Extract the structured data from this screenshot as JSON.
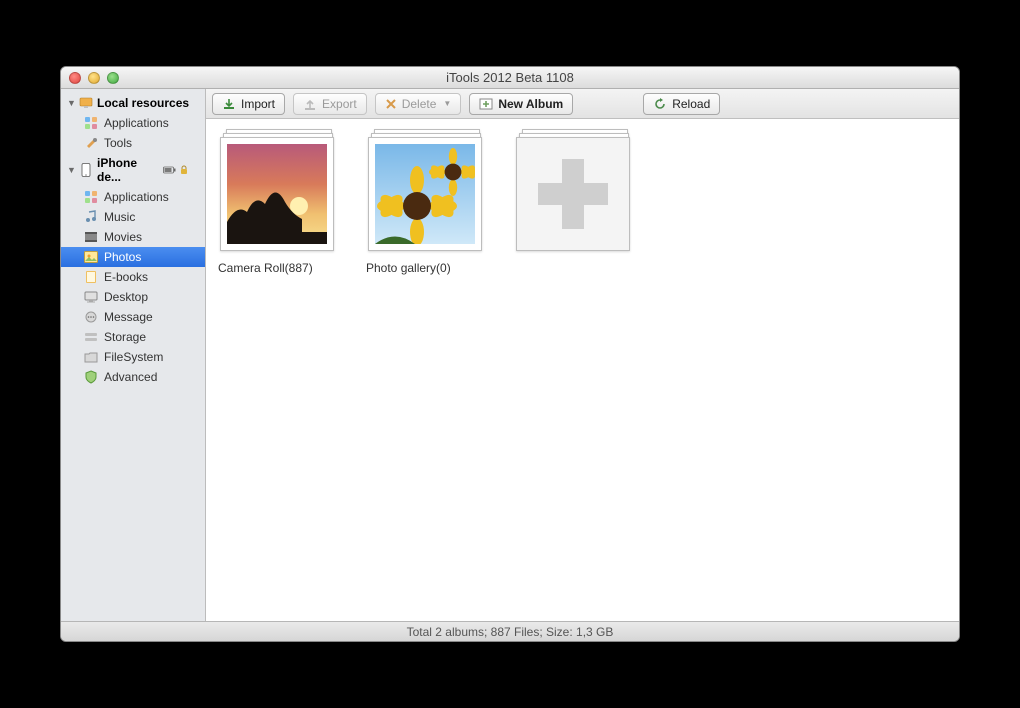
{
  "window": {
    "title": "iTools 2012 Beta 1108"
  },
  "sidebar": {
    "sections": [
      {
        "label": "Local resources",
        "items": [
          {
            "label": "Applications",
            "icon": "apps-icon"
          },
          {
            "label": "Tools",
            "icon": "tools-icon"
          }
        ]
      },
      {
        "label": "iPhone de...",
        "items": [
          {
            "label": "Applications",
            "icon": "apps-icon"
          },
          {
            "label": "Music",
            "icon": "music-icon"
          },
          {
            "label": "Movies",
            "icon": "movies-icon"
          },
          {
            "label": "Photos",
            "icon": "photos-icon",
            "selected": true
          },
          {
            "label": "E-books",
            "icon": "ebooks-icon"
          },
          {
            "label": "Desktop",
            "icon": "desktop-icon"
          },
          {
            "label": "Message",
            "icon": "message-icon"
          },
          {
            "label": "Storage",
            "icon": "storage-icon"
          },
          {
            "label": "FileSystem",
            "icon": "filesystem-icon"
          },
          {
            "label": "Advanced",
            "icon": "advanced-icon"
          }
        ]
      }
    ]
  },
  "toolbar": {
    "import": "Import",
    "export": "Export",
    "delete": "Delete",
    "new_album": "New Album",
    "reload": "Reload"
  },
  "albums": [
    {
      "label": "Camera Roll(887)",
      "type": "sunset"
    },
    {
      "label": "Photo gallery(0)",
      "type": "sunflower"
    },
    {
      "label": "",
      "type": "add"
    }
  ],
  "status": "Total 2 albums; 887 Files;  Size: 1,3 GB"
}
